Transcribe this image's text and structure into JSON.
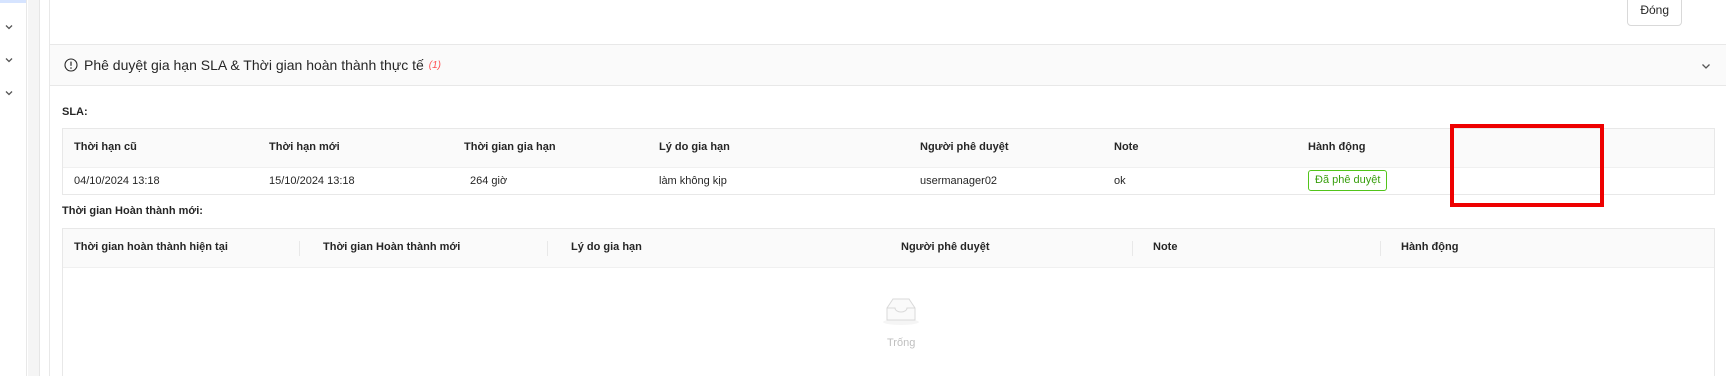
{
  "header": {
    "close_label": "Đóng"
  },
  "section": {
    "title": "Phê duyệt gia hạn SLA & Thời gian hoàn thành thực tế",
    "count": "(1)"
  },
  "sla": {
    "label": "SLA:",
    "columns": [
      "Thời hạn cũ",
      "Thời hạn mới",
      "Thời gian gia hạn",
      "Lý do gia hạn",
      "Người phê duyệt",
      "Note",
      "Hành động"
    ],
    "rows": [
      {
        "old_deadline": "04/10/2024 13:18",
        "new_deadline": "15/10/2024 13:18",
        "extension": "264 giờ",
        "reason": "làm không kịp",
        "approver": "usermanager02",
        "note": "ok",
        "action": "Đã phê duyệt"
      }
    ]
  },
  "completion": {
    "label": "Thời gian Hoàn thành mới:",
    "columns": [
      "Thời gian hoàn thành hiện tại",
      "Thời gian Hoàn thành mới",
      "Lý do gia hạn",
      "Người phê duyệt",
      "Note",
      "Hành động"
    ],
    "empty_text": "Trống"
  },
  "colors": {
    "approved_green": "#52c41a",
    "highlight_red": "#ee0000",
    "count_red": "#ff4d4f"
  }
}
